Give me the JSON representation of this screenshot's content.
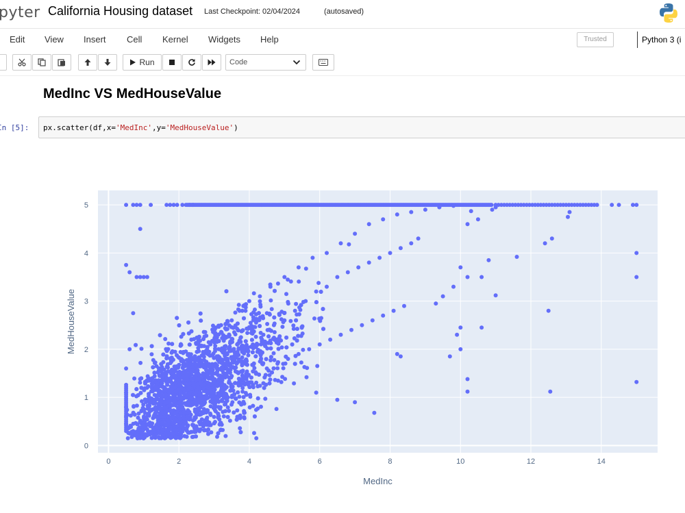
{
  "header": {
    "logo_text": "pyter",
    "notebook_title": "California Housing dataset",
    "checkpoint": "Last Checkpoint: 02/04/2024",
    "autosave_status": "(autosaved)"
  },
  "menu": {
    "items": [
      "Edit",
      "View",
      "Insert",
      "Cell",
      "Kernel",
      "Widgets",
      "Help"
    ],
    "trusted": "Trusted",
    "kernel": "Python 3 (i"
  },
  "toolbar": {
    "run_label": "Run",
    "cell_type": "Code",
    "icons": [
      "cut-icon",
      "copy-icon",
      "paste-icon",
      "arrow-up-icon",
      "arrow-down-icon",
      "play-icon",
      "stop-icon",
      "restart-icon",
      "fast-forward-icon",
      "keyboard-icon"
    ]
  },
  "notebook": {
    "markdown_heading": "MedInc VS MedHouseValue",
    "cell_prompt": "In [5]:",
    "code_prefix": "px.scatter(df,x=",
    "code_x": "'MedInc'",
    "code_mid": ",y=",
    "code_y": "'MedHouseValue'",
    "code_suffix": ")"
  },
  "colors": {
    "marker": "#636efa",
    "plot_bg": "#e5ecf6",
    "prompt": "#303f9f",
    "string": "#ba2121"
  },
  "chart_data": {
    "type": "scatter",
    "xlabel": "MedInc",
    "ylabel": "MedHouseValue",
    "xlim": [
      -0.3,
      15.6
    ],
    "ylim": [
      -0.15,
      5.3
    ],
    "xticks": [
      0,
      2,
      4,
      6,
      8,
      10,
      12,
      14
    ],
    "yticks": [
      0,
      1,
      2,
      3,
      4,
      5
    ],
    "grid": true,
    "marker_color": "#636efa",
    "points": [
      [
        0.5,
        5.0
      ],
      [
        0.7,
        5.0
      ],
      [
        0.8,
        5.0
      ],
      [
        0.9,
        5.0
      ],
      [
        1.2,
        5.0
      ],
      [
        1.65,
        5.0
      ],
      [
        1.75,
        5.0
      ],
      [
        1.85,
        5.0
      ],
      [
        1.95,
        5.0
      ],
      [
        2.1,
        5.0
      ],
      [
        2.3,
        5.0
      ],
      [
        2.4,
        5.0
      ],
      [
        10.3,
        4.87
      ],
      [
        10.9,
        4.9
      ],
      [
        11.0,
        4.95
      ],
      [
        10.5,
        4.7
      ],
      [
        10.2,
        4.6
      ],
      [
        13.1,
        4.85
      ],
      [
        13.05,
        4.75
      ],
      [
        12.6,
        4.3
      ],
      [
        12.4,
        4.2
      ],
      [
        11.6,
        3.92
      ],
      [
        10.8,
        3.85
      ],
      [
        10.0,
        3.7
      ],
      [
        10.6,
        3.5
      ],
      [
        10.2,
        3.5
      ],
      [
        9.8,
        3.3
      ],
      [
        9.5,
        3.1
      ],
      [
        9.3,
        2.95
      ],
      [
        11.0,
        3.12
      ],
      [
        12.5,
        2.8
      ],
      [
        10.6,
        2.45
      ],
      [
        10.0,
        2.45
      ],
      [
        9.9,
        2.3
      ],
      [
        10.0,
        2.0
      ],
      [
        9.7,
        1.85
      ],
      [
        10.2,
        1.38
      ],
      [
        10.2,
        1.12
      ],
      [
        12.55,
        1.12
      ],
      [
        15.0,
        4.0
      ],
      [
        15.0,
        3.5
      ],
      [
        15.0,
        1.32
      ],
      [
        7.55,
        0.68
      ],
      [
        7.0,
        0.9
      ],
      [
        6.5,
        0.95
      ],
      [
        5.9,
        1.1
      ],
      [
        8.2,
        1.9
      ],
      [
        8.3,
        1.85
      ],
      [
        0.5,
        3.75
      ],
      [
        0.6,
        3.6
      ],
      [
        0.8,
        3.5
      ],
      [
        0.9,
        3.5
      ],
      [
        1.0,
        3.5
      ],
      [
        1.1,
        3.5
      ],
      [
        0.9,
        4.5
      ],
      [
        0.7,
        2.75
      ],
      [
        0.6,
        2.0
      ],
      [
        0.5,
        1.6
      ],
      [
        0.5,
        1.1
      ],
      [
        0.5,
        0.8
      ],
      [
        0.5,
        0.6
      ],
      [
        0.5,
        0.45
      ],
      [
        0.55,
        0.35
      ],
      [
        0.6,
        0.25
      ],
      [
        0.55,
        0.15
      ],
      [
        0.7,
        0.3
      ],
      [
        0.8,
        0.2
      ],
      [
        1.0,
        0.15
      ],
      [
        1.2,
        0.25
      ],
      [
        1.6,
        0.15
      ],
      [
        1.8,
        0.2
      ],
      [
        4.2,
        0.15
      ],
      [
        1.9,
        1.3
      ],
      [
        2.2,
        1.5
      ],
      [
        2.5,
        1.8
      ],
      [
        2.8,
        2.0
      ],
      [
        3.0,
        2.2
      ],
      [
        3.2,
        2.5
      ],
      [
        3.5,
        2.6
      ],
      [
        3.8,
        2.8
      ],
      [
        4.0,
        3.0
      ],
      [
        4.3,
        3.1
      ],
      [
        4.6,
        3.3
      ],
      [
        5.0,
        3.5
      ],
      [
        5.4,
        3.7
      ],
      [
        5.8,
        3.9
      ],
      [
        6.2,
        4.0
      ],
      [
        6.6,
        4.2
      ],
      [
        7.0,
        4.4
      ],
      [
        7.4,
        4.6
      ],
      [
        7.8,
        4.7
      ],
      [
        8.2,
        4.8
      ],
      [
        8.6,
        4.85
      ],
      [
        9.0,
        4.9
      ],
      [
        9.4,
        4.95
      ],
      [
        9.8,
        4.98
      ],
      [
        2.0,
        1.0
      ],
      [
        2.3,
        1.2
      ],
      [
        2.6,
        1.3
      ],
      [
        2.9,
        1.5
      ],
      [
        3.2,
        1.6
      ],
      [
        3.5,
        1.8
      ],
      [
        3.8,
        2.0
      ],
      [
        4.1,
        2.1
      ],
      [
        4.4,
        2.3
      ],
      [
        4.7,
        2.5
      ],
      [
        5.0,
        2.6
      ],
      [
        5.3,
        2.8
      ],
      [
        5.6,
        3.0
      ],
      [
        5.9,
        3.2
      ],
      [
        6.2,
        3.3
      ],
      [
        6.5,
        3.5
      ],
      [
        6.8,
        3.6
      ],
      [
        7.1,
        3.7
      ],
      [
        7.4,
        3.8
      ],
      [
        7.7,
        3.9
      ],
      [
        8.0,
        4.0
      ],
      [
        8.3,
        4.1
      ],
      [
        8.6,
        4.2
      ],
      [
        8.8,
        4.3
      ],
      [
        1.5,
        0.6
      ],
      [
        1.8,
        0.7
      ],
      [
        2.1,
        0.8
      ],
      [
        2.4,
        0.9
      ],
      [
        2.7,
        1.0
      ],
      [
        3.0,
        1.1
      ],
      [
        3.3,
        1.2
      ],
      [
        3.6,
        1.3
      ],
      [
        3.9,
        1.4
      ],
      [
        4.2,
        1.5
      ],
      [
        4.5,
        1.6
      ],
      [
        4.8,
        1.7
      ],
      [
        5.1,
        1.8
      ],
      [
        5.4,
        1.9
      ],
      [
        5.7,
        2.0
      ],
      [
        6.0,
        2.1
      ],
      [
        6.3,
        2.2
      ],
      [
        6.6,
        2.3
      ],
      [
        6.9,
        2.4
      ],
      [
        7.2,
        2.5
      ],
      [
        7.5,
        2.6
      ],
      [
        7.8,
        2.7
      ],
      [
        8.1,
        2.8
      ],
      [
        8.4,
        2.9
      ]
    ]
  }
}
